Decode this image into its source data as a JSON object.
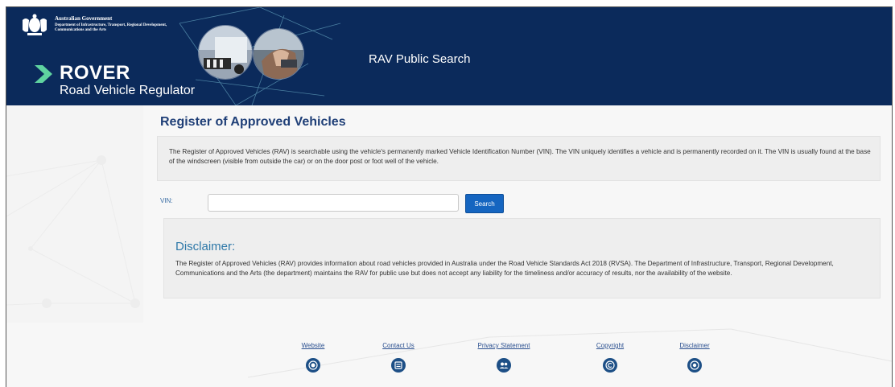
{
  "header": {
    "gov_title": "Australian Government",
    "gov_dept": "Department of Infrastructure, Transport, Regional Development, Communications and the Arts",
    "brand_name": "ROVER",
    "brand_tagline": "Road Vehicle Regulator",
    "app_title": "RAV Public Search"
  },
  "main": {
    "page_title": "Register of Approved Vehicles",
    "intro": "The Register of Approved Vehicles (RAV) is searchable using the vehicle's permanently marked Vehicle Identification Number (VIN). The VIN uniquely identifies a vehicle and is permanently recorded on it. The VIN is usually found at the base of the windscreen (visible from outside the car) or on the door post or foot well of the vehicle.",
    "search": {
      "label": "VIN:",
      "value": "",
      "placeholder": "",
      "button_label": "Search"
    },
    "disclaimer": {
      "title": "Disclaimer:",
      "text": "The Register of Approved Vehicles (RAV) provides information about road vehicles provided in Australia under the Road Vehicle Standards Act 2018 (RVSA). The Department of Infrastructure, Transport, Regional Development, Communications and the Arts (the department) maintains the RAV for public use but does not accept any liability for the timeliness and/or accuracy of results, nor the availability of the website."
    }
  },
  "footer": {
    "links": [
      {
        "label": "Website",
        "icon": "globe-icon"
      },
      {
        "label": "Contact Us",
        "icon": "contact-icon"
      },
      {
        "label": "Privacy Statement",
        "icon": "people-icon"
      },
      {
        "label": "Copyright",
        "icon": "copyright-icon"
      },
      {
        "label": "Disclaimer",
        "icon": "info-icon"
      }
    ]
  },
  "colors": {
    "header_bg": "#0b2a5b",
    "brand_arrow": "#5fd3a0",
    "title_blue": "#1f3f77",
    "accent_blue": "#1565c0",
    "disclaimer_title": "#2e78a8"
  }
}
